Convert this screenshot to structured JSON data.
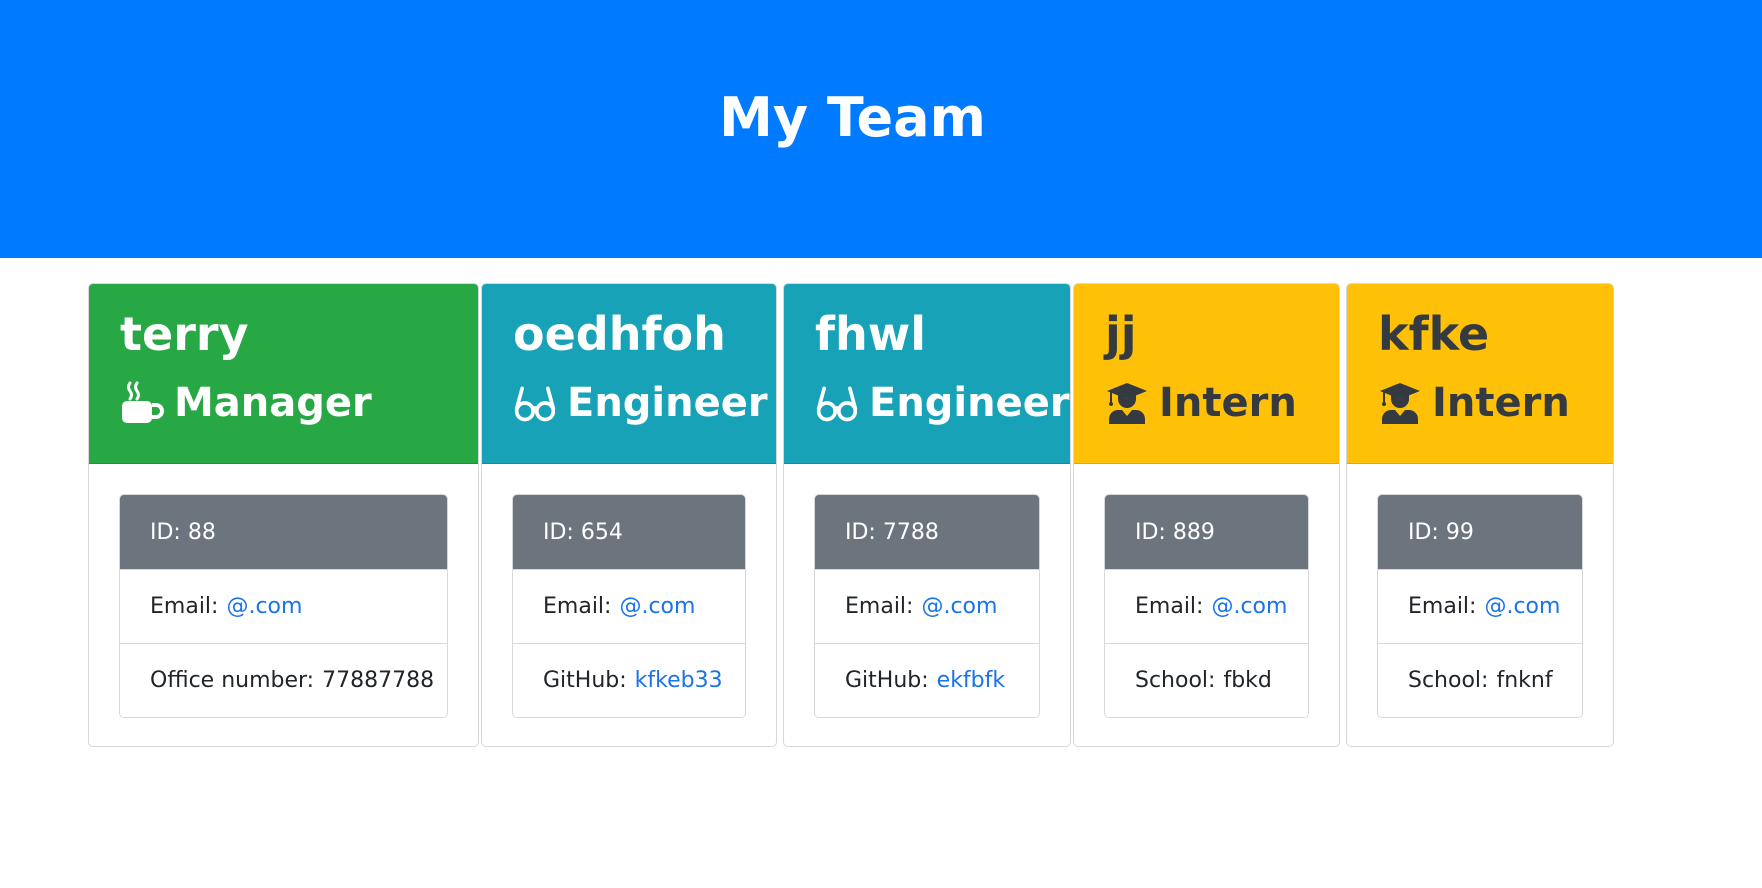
{
  "header": {
    "title": "My Team"
  },
  "colors": {
    "jumbotron": "#007bff",
    "manager": "#28a745",
    "engineer": "#17a2b8",
    "intern": "#ffc107",
    "id_bar": "#6c757d",
    "link": "#1a73e8"
  },
  "employees": [
    {
      "name": "terry",
      "role": "Manager",
      "icon": "coffee-mug-icon",
      "id_label": "ID: 88",
      "email_label": "Email:",
      "email": "@.com",
      "detail_label": "Office number:",
      "detail_value": "77887788"
    },
    {
      "name": "oedhfoh",
      "role": "Engineer",
      "icon": "glasses-icon",
      "id_label": "ID: 654",
      "email_label": "Email:",
      "email": "@.com",
      "detail_label": "GitHub:",
      "detail_value": "kfkeb33"
    },
    {
      "name": "fhwl",
      "role": "Engineer",
      "icon": "glasses-icon",
      "id_label": "ID: 7788",
      "email_label": "Email:",
      "email": "@.com",
      "detail_label": "GitHub:",
      "detail_value": "ekfbfk"
    },
    {
      "name": "jj",
      "role": "Intern",
      "icon": "graduate-icon",
      "id_label": "ID: 889",
      "email_label": "Email:",
      "email": "@.com",
      "detail_label": "School:",
      "detail_value": "fbkd"
    },
    {
      "name": "kfke",
      "role": "Intern",
      "icon": "graduate-icon",
      "id_label": "ID: 99",
      "email_label": "Email:",
      "email": "@.com",
      "detail_label": "School:",
      "detail_value": "fnknf"
    }
  ],
  "stray_marks": [
    ",",
    ","
  ]
}
